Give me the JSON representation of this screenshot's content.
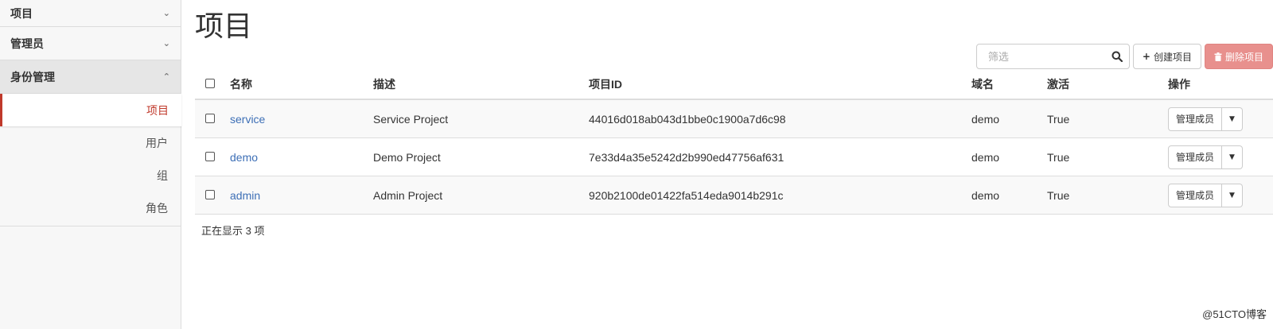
{
  "sidebar": {
    "sections": [
      {
        "label": "项目",
        "chevron": "chevron-down-icon"
      },
      {
        "label": "管理员",
        "chevron": "chevron-down-icon"
      },
      {
        "label": "身份管理",
        "chevron": "chevron-up-icon"
      }
    ],
    "identity_items": [
      {
        "label": "项目",
        "selected": true
      },
      {
        "label": "用户",
        "selected": false
      },
      {
        "label": "组",
        "selected": false
      },
      {
        "label": "角色",
        "selected": false
      }
    ]
  },
  "main": {
    "title": "项目",
    "search": {
      "placeholder": "筛选",
      "value": ""
    },
    "create_button": "创建项目",
    "delete_button": "删除项目",
    "table": {
      "columns": [
        "名称",
        "描述",
        "项目ID",
        "域名",
        "激活",
        "操作"
      ],
      "rows": [
        {
          "name": "service",
          "description": "Service Project",
          "id": "44016d018ab043d1bbe0c1900a7d6c98",
          "domain": "demo",
          "enabled": "True",
          "action": "管理成员"
        },
        {
          "name": "demo",
          "description": "Demo Project",
          "id": "7e33d4a35e5242d2b990ed47756af631",
          "domain": "demo",
          "enabled": "True",
          "action": "管理成员"
        },
        {
          "name": "admin",
          "description": "Admin Project",
          "id": "920b2100de01422fa514eda9014b291c",
          "domain": "demo",
          "enabled": "True",
          "action": "管理成员"
        }
      ]
    },
    "footer": "正在显示 3 项"
  },
  "watermark": "@51CTO博客",
  "colors": {
    "accent": "#c0392b",
    "link": "#3d6fb6",
    "danger_button": "#e8908d"
  }
}
